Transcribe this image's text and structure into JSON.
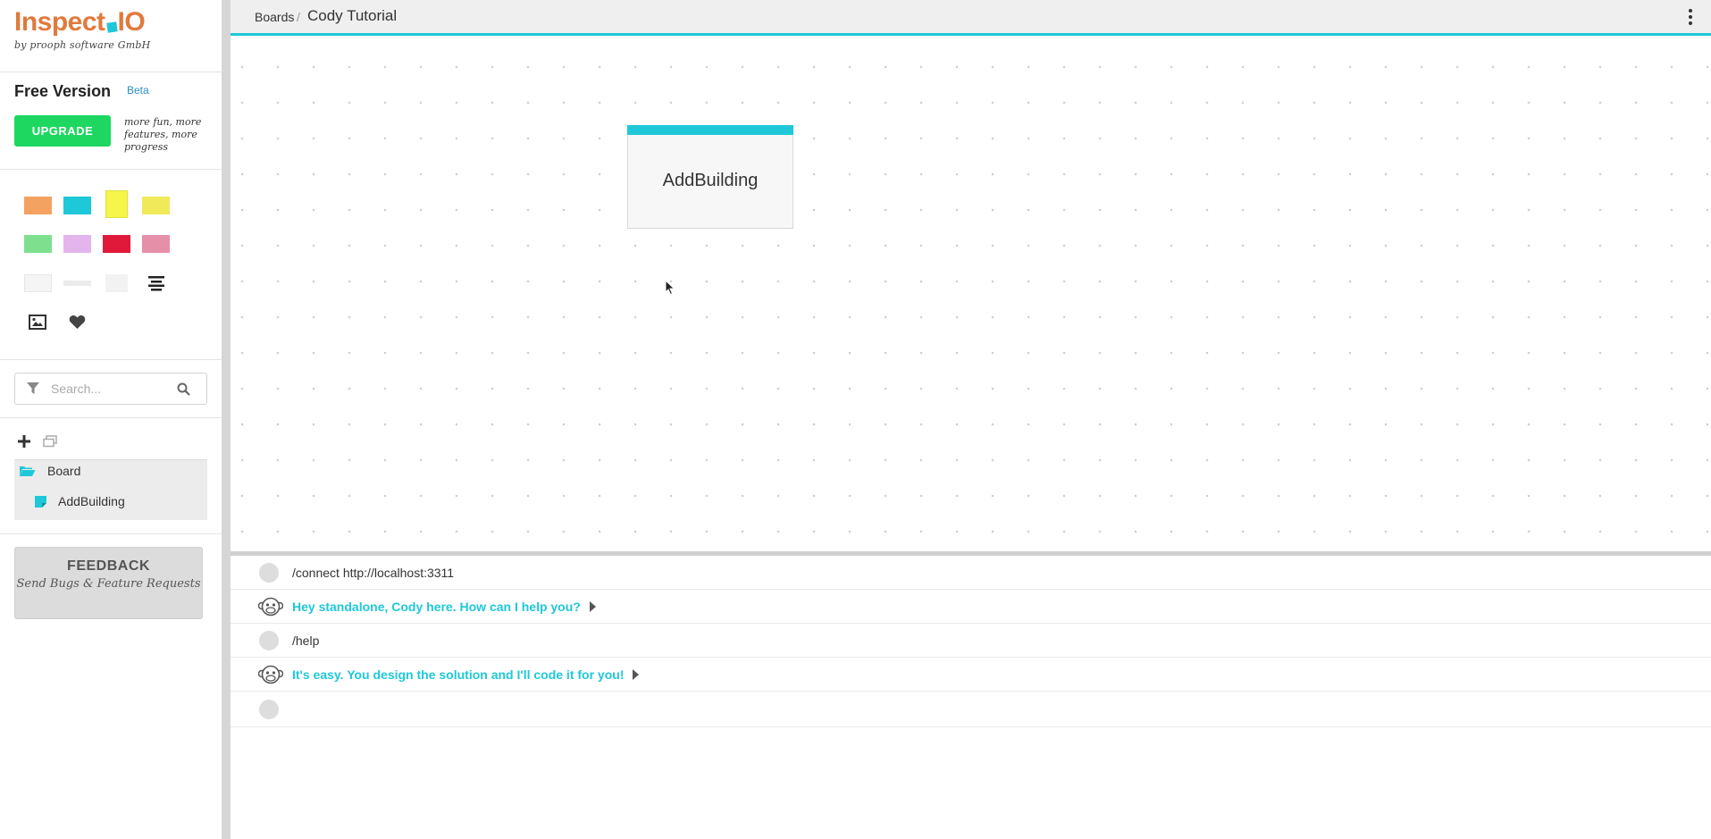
{
  "app": {
    "brand_left": "Inspect",
    "brand_right": "IO",
    "byline": "by prooph software GmbH"
  },
  "plan": {
    "title": "Free Version",
    "badge": "Beta",
    "upgrade_label": "UPGRADE",
    "upgrade_note": "more fun, more features, more progress"
  },
  "palette": {
    "colors": [
      "#f4a261",
      "#1fc8d8",
      "#f5f54a",
      "#f0e95a",
      "#7ee08f",
      "#e4b5ec",
      "#e0193a",
      "#e68fa8"
    ]
  },
  "search": {
    "placeholder": "Search..."
  },
  "tree": {
    "folder_label": "Board",
    "item_label": "AddBuilding"
  },
  "feedback": {
    "title": "FEEDBACK",
    "subtitle": "Send Bugs & Feature Requests"
  },
  "topbar": {
    "breadcrumb_root": "Boards",
    "separator": "/",
    "board_title": "Cody Tutorial"
  },
  "canvas": {
    "sticky_label": "AddBuilding",
    "sticky_color": "#1fc8d8"
  },
  "console": {
    "lines": [
      {
        "type": "user",
        "text": "/connect http://localhost:3311"
      },
      {
        "type": "cody",
        "text": "Hey standalone, Cody here. How can I help you?"
      },
      {
        "type": "user",
        "text": "/help"
      },
      {
        "type": "cody",
        "text": "It's easy. You design the solution and I'll code it for you!"
      },
      {
        "type": "user",
        "text": ""
      }
    ]
  }
}
